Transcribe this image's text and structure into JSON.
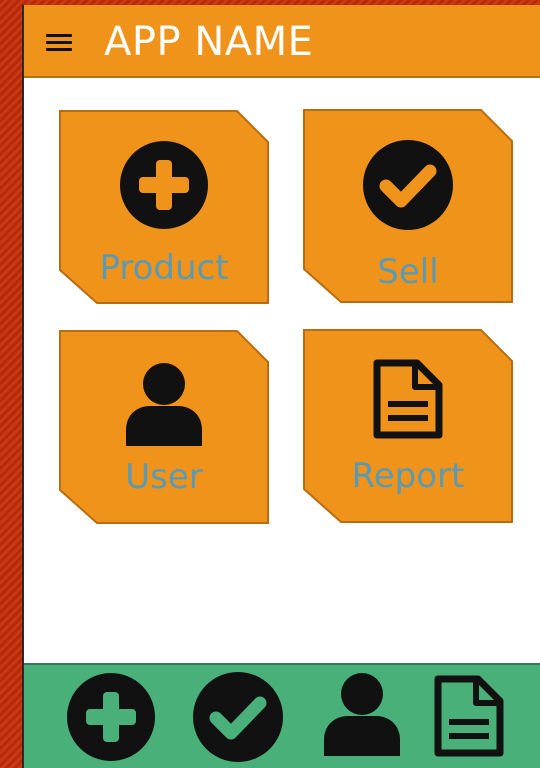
{
  "header": {
    "title": "APP NAME",
    "menu_icon": "hamburger-menu-icon"
  },
  "tiles": [
    {
      "label": "Product",
      "icon": "plus-circle-icon"
    },
    {
      "label": "Sell",
      "icon": "check-circle-icon"
    },
    {
      "label": "User",
      "icon": "user-icon"
    },
    {
      "label": "Report",
      "icon": "document-icon"
    }
  ],
  "footer": {
    "buttons": [
      {
        "icon": "plus-circle-icon"
      },
      {
        "icon": "check-circle-icon"
      },
      {
        "icon": "user-icon"
      },
      {
        "icon": "document-icon"
      }
    ]
  },
  "colors": {
    "header_bg": "#f0931b",
    "tile_bg": "#f0931b",
    "tile_border": "#b86d12",
    "tile_label": "#5b9ab5",
    "footer_bg": "#48b078",
    "icon": "#111111",
    "background_stripes": "#b8280a"
  }
}
